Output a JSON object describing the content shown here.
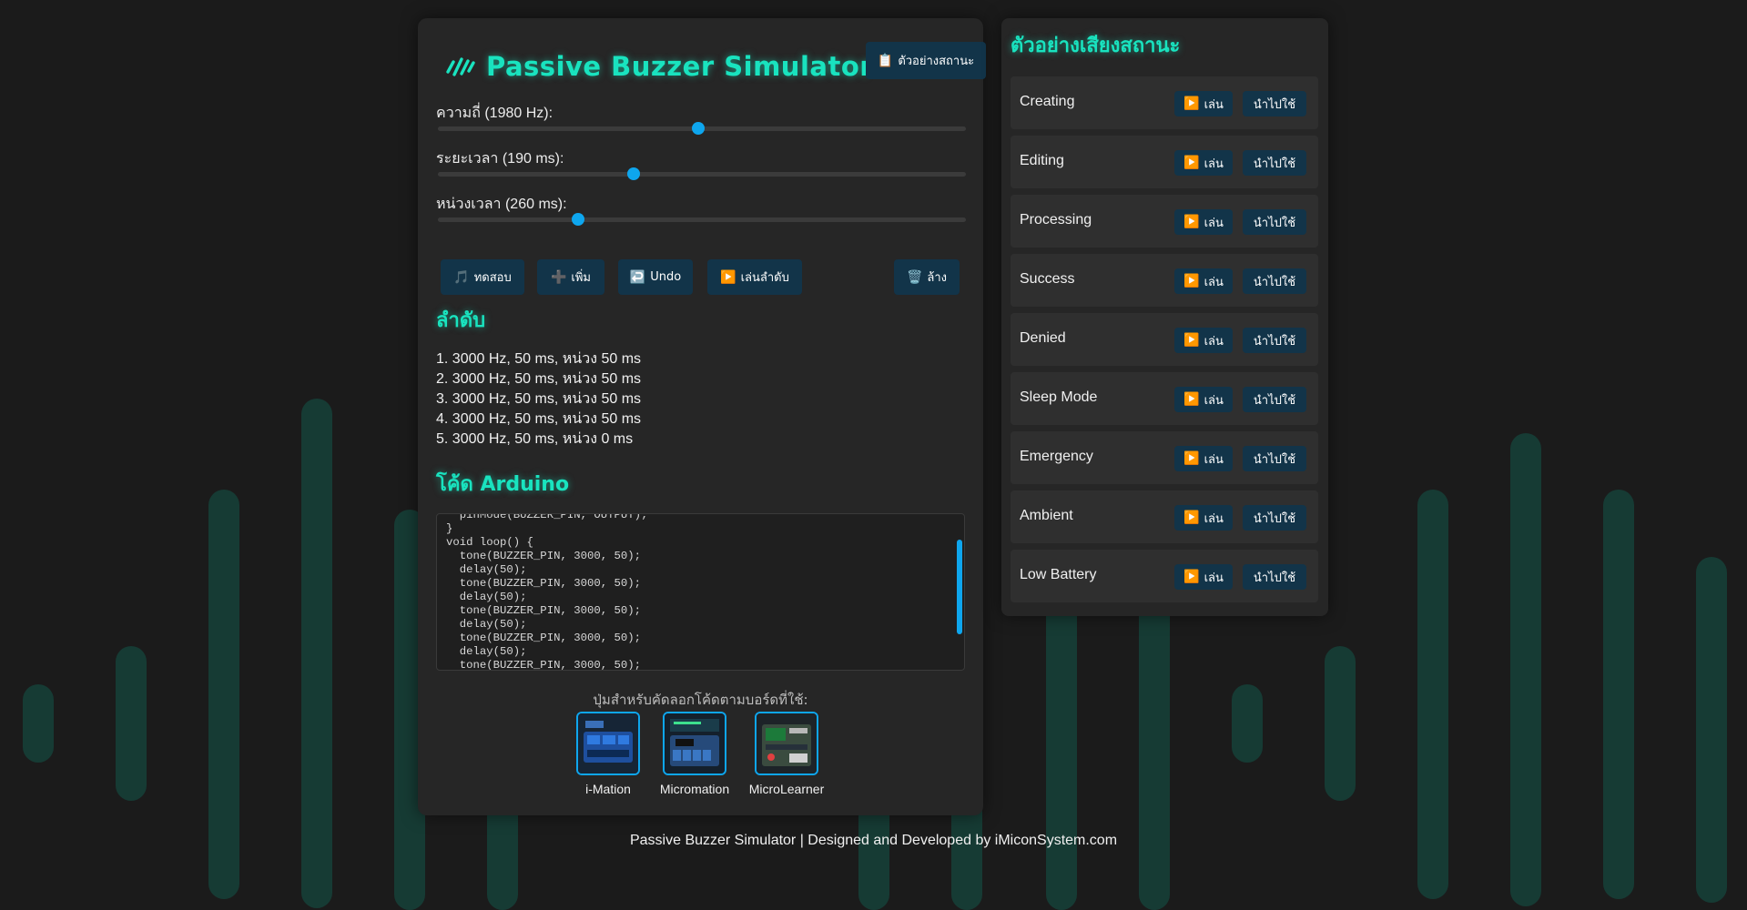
{
  "app": {
    "title": "Passive Buzzer Simulator",
    "samples_button": "ตัวอย่างสถานะ"
  },
  "sliders": [
    {
      "label": "ความถี่ (1980 Hz):",
      "value": 1980,
      "min": 20,
      "max": 4000
    },
    {
      "label": "ระยะเวลา (190 ms):",
      "value": 190,
      "min": 10,
      "max": 500
    },
    {
      "label": "หน่วงเวลา (260 ms):",
      "value": 260,
      "min": 0,
      "max": 1000
    }
  ],
  "controls": {
    "test": "ทดสอบ",
    "add": "เพิ่ม",
    "undo": "Undo",
    "play_sequence": "เล่นลำดับ",
    "clear": "ล้าง"
  },
  "sequence": {
    "title": "ลำดับ",
    "items": [
      "1. 3000 Hz, 50 ms, หน่วง 50 ms",
      "2. 3000 Hz, 50 ms, หน่วง 50 ms",
      "3. 3000 Hz, 50 ms, หน่วง 50 ms",
      "4. 3000 Hz, 50 ms, หน่วง 50 ms",
      "5. 3000 Hz, 50 ms, หน่วง 0 ms"
    ]
  },
  "code": {
    "title": "โค้ด Arduino",
    "text": "  pinMode(BUZZER_PIN, OUTPUT);\n}\nvoid loop() {\n  tone(BUZZER_PIN, 3000, 50);\n  delay(50);\n  tone(BUZZER_PIN, 3000, 50);\n  delay(50);\n  tone(BUZZER_PIN, 3000, 50);\n  delay(50);\n  tone(BUZZER_PIN, 3000, 50);\n  delay(50);\n  tone(BUZZER_PIN, 3000, 50);"
  },
  "boards": {
    "label": "ปุ่มสำหรับคัดลอกโค้ดตามบอร์ดที่ใช้:",
    "items": [
      {
        "name": "i-Mation"
      },
      {
        "name": "Micromation"
      },
      {
        "name": "MicroLearner"
      }
    ]
  },
  "samples": {
    "title": "ตัวอย่างเสียงสถานะ",
    "play_label": "เล่น",
    "apply_label": "นำไปใช้",
    "items": [
      "Creating",
      "Editing",
      "Processing",
      "Success",
      "Denied",
      "Sleep Mode",
      "Emergency",
      "Ambient",
      "Low Battery"
    ]
  },
  "footer": "Passive Buzzer Simulator | Designed and Developed by iMiconSystem.com",
  "colors": {
    "accent": "#19e3bf",
    "button_bg": "#123449",
    "slider": "#0ea6ee",
    "background": "#1b1b1b",
    "panel": "#262626"
  }
}
